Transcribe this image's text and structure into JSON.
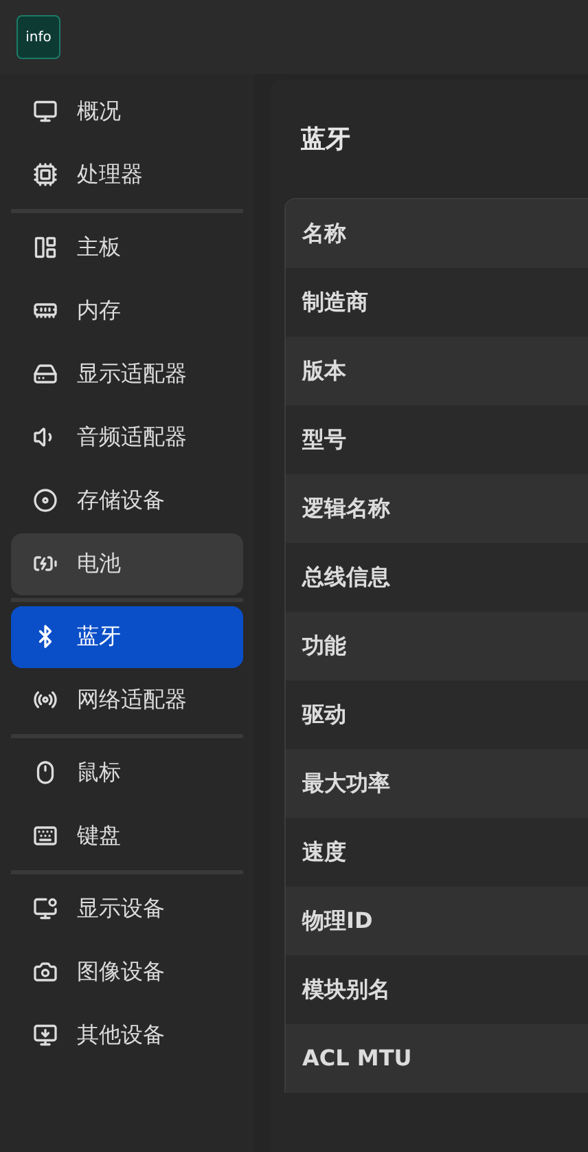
{
  "app_logo": {
    "text": "info"
  },
  "sidebar": {
    "groups": [
      {
        "items": [
          {
            "label": "概况",
            "selected": false,
            "hovered": false
          },
          {
            "label": "处理器",
            "selected": false,
            "hovered": false
          }
        ]
      },
      {
        "items": [
          {
            "label": "主板",
            "selected": false,
            "hovered": false
          },
          {
            "label": "内存",
            "selected": false,
            "hovered": false
          },
          {
            "label": "显示适配器",
            "selected": false,
            "hovered": false
          },
          {
            "label": "音频适配器",
            "selected": false,
            "hovered": false
          },
          {
            "label": "存储设备",
            "selected": false,
            "hovered": false
          },
          {
            "label": "电池",
            "selected": false,
            "hovered": true
          }
        ]
      },
      {
        "items": [
          {
            "label": "蓝牙",
            "selected": true,
            "hovered": false
          },
          {
            "label": "网络适配器",
            "selected": false,
            "hovered": false
          }
        ]
      },
      {
        "items": [
          {
            "label": "鼠标",
            "selected": false,
            "hovered": false
          },
          {
            "label": "键盘",
            "selected": false,
            "hovered": false
          }
        ]
      },
      {
        "items": [
          {
            "label": "显示设备",
            "selected": false,
            "hovered": false
          },
          {
            "label": "图像设备",
            "selected": false,
            "hovered": false
          },
          {
            "label": "其他设备",
            "selected": false,
            "hovered": false
          }
        ]
      }
    ]
  },
  "content": {
    "title": "蓝牙",
    "table": {
      "rows": [
        {
          "label": "名称"
        },
        {
          "label": "制造商"
        },
        {
          "label": "版本"
        },
        {
          "label": "型号"
        },
        {
          "label": "逻辑名称"
        },
        {
          "label": "总线信息"
        },
        {
          "label": "功能"
        },
        {
          "label": "驱动"
        },
        {
          "label": "最大功率"
        },
        {
          "label": "速度"
        },
        {
          "label": "物理ID"
        },
        {
          "label": "模块别名"
        },
        {
          "label": "ACL MTU"
        }
      ]
    }
  }
}
